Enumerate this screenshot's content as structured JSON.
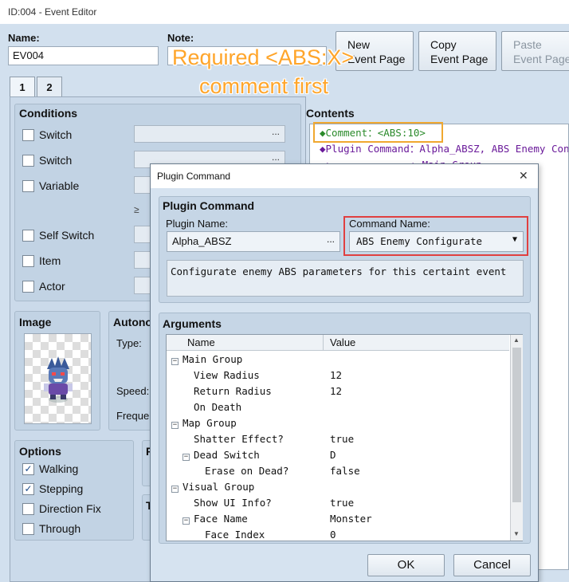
{
  "window": {
    "title": "ID:004 - Event Editor"
  },
  "editor": {
    "name_label": "Name:",
    "name_value": "EV004",
    "note_label": "Note:",
    "new_page_button": "New\nEvent Page",
    "copy_page_button": "Copy\nEvent Page",
    "paste_page_button": "Paste\nEvent Page",
    "tabs": [
      "1",
      "2"
    ],
    "conditions": {
      "title": "Conditions",
      "items": [
        {
          "label": "Switch",
          "checked": false
        },
        {
          "label": "Switch",
          "checked": false
        },
        {
          "label": "Variable",
          "checked": false
        },
        {
          "label": "Self Switch",
          "checked": false
        },
        {
          "label": "Item",
          "checked": false
        },
        {
          "label": "Actor",
          "checked": false
        }
      ],
      "dots": "...",
      "ge_symbol": "≥"
    },
    "image_title": "Image",
    "autonomous": {
      "title": "Autono",
      "type_label": "Type:",
      "speed_label": "Speed:",
      "freq_label": "Freque"
    },
    "options": {
      "title": "Options",
      "items": [
        {
          "label": "Walking",
          "checked": true
        },
        {
          "label": "Stepping",
          "checked": true
        },
        {
          "label": "Direction Fix",
          "checked": false
        },
        {
          "label": "Through",
          "checked": false
        }
      ],
      "check_glyph": "✓"
    },
    "priority_initial": "P",
    "trigger_initial": "T",
    "contents": {
      "title": "Contents",
      "lines": [
        {
          "prefix": "◆Comment：",
          "text": "<ABS:10>"
        },
        {
          "prefix": "◆Plugin Command：",
          "text": "Alpha_ABSZ, ABS Enemy Confi"
        },
        {
          "prefix": ":",
          "text": ": Main Group ="
        }
      ]
    }
  },
  "annotation": {
    "line1": "Required <ABS:X>",
    "line2": "comment first",
    "color": "#ffa52a"
  },
  "dialog": {
    "title": "Plugin Command",
    "close_glyph": "✕",
    "section_title": "Plugin Command",
    "plugin_name_label": "Plugin Name:",
    "plugin_name_value": "Alpha_ABSZ",
    "plugin_dots": "...",
    "command_name_label": "Command Name:",
    "command_name_value": "ABS Enemy Configurate",
    "command_arrow": "▼",
    "description": "Configurate enemy ABS parameters for this certaint event",
    "arguments_title": "Arguments",
    "col_name": "Name",
    "col_value": "Value",
    "rows": [
      {
        "name": "Main Group",
        "value": "",
        "indent": 0,
        "group": true
      },
      {
        "name": "View Radius",
        "value": "12",
        "indent": 1,
        "group": false
      },
      {
        "name": "Return Radius",
        "value": "12",
        "indent": 1,
        "group": false
      },
      {
        "name": "On Death",
        "value": "",
        "indent": 1,
        "group": false
      },
      {
        "name": "Map Group",
        "value": "",
        "indent": 0,
        "group": true
      },
      {
        "name": "Shatter Effect?",
        "value": "true",
        "indent": 1,
        "group": false
      },
      {
        "name": "Dead Switch",
        "value": "D",
        "indent": 1,
        "group": true
      },
      {
        "name": "Erase on Dead?",
        "value": "false",
        "indent": 2,
        "group": false
      },
      {
        "name": "Visual Group",
        "value": "",
        "indent": 0,
        "group": true
      },
      {
        "name": "Show UI Info?",
        "value": "true",
        "indent": 1,
        "group": false
      },
      {
        "name": "Face Name",
        "value": "Monster",
        "indent": 1,
        "group": true
      },
      {
        "name": "Face Index",
        "value": "0",
        "indent": 2,
        "group": false
      }
    ],
    "expand_glyph": "−",
    "ok_button": "OK",
    "cancel_button": "Cancel",
    "scroll_up": "▲",
    "scroll_down": "▼"
  },
  "colors": {
    "highlight_orange": "#f0a830",
    "highlight_red": "#e04040",
    "comment_green": "#2a8a2a",
    "command_purple": "#6a1a9a"
  }
}
